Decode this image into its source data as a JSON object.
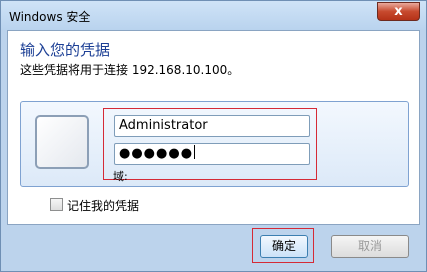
{
  "window": {
    "title": "Windows 安全",
    "close_symbol": "x"
  },
  "main": {
    "heading": "输入您的凭据",
    "subline": "这些凭据将用于连接 192.168.10.100。"
  },
  "credentials": {
    "username": "Administrator",
    "password_mask": "●●●●●●",
    "domain_label": "域:"
  },
  "options": {
    "remember_label": "记住我的凭据",
    "remember_checked": false
  },
  "buttons": {
    "ok_label": "确定",
    "cancel_label": "取消"
  },
  "colors": {
    "heading": "#1c3f95",
    "highlight_box": "#d52a36",
    "frame": "#bcd3ec"
  }
}
